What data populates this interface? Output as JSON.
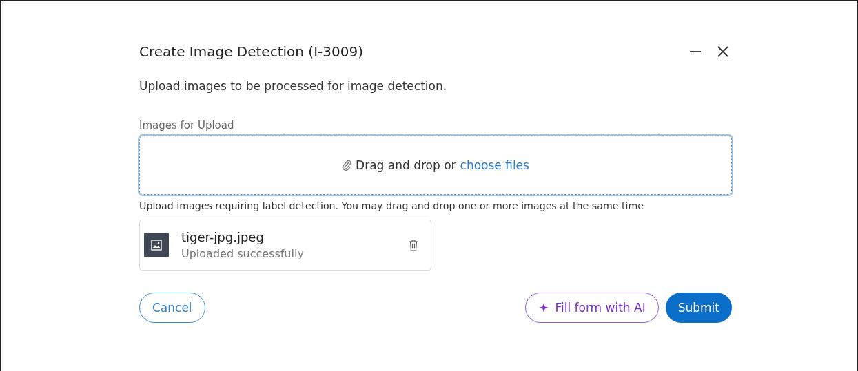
{
  "dialog": {
    "title": "Create Image Detection (I-3009)",
    "description": "Upload images to be processed for image detection."
  },
  "upload": {
    "label": "Images for Upload",
    "drop_text": "Drag and drop or",
    "link": "choose files",
    "hint": "Upload images requiring label detection. You may drag and drop one or more images at the same time",
    "focused": true
  },
  "files": [
    {
      "name": "tiger-jpg.jpeg",
      "status": "Uploaded successfully"
    }
  ],
  "buttons": [
    {
      "kind": "outline",
      "label": "Cancel"
    },
    {
      "kind": "ai",
      "label": "Fill form with AI"
    },
    {
      "kind": "primary",
      "label": "Submit"
    }
  ]
}
